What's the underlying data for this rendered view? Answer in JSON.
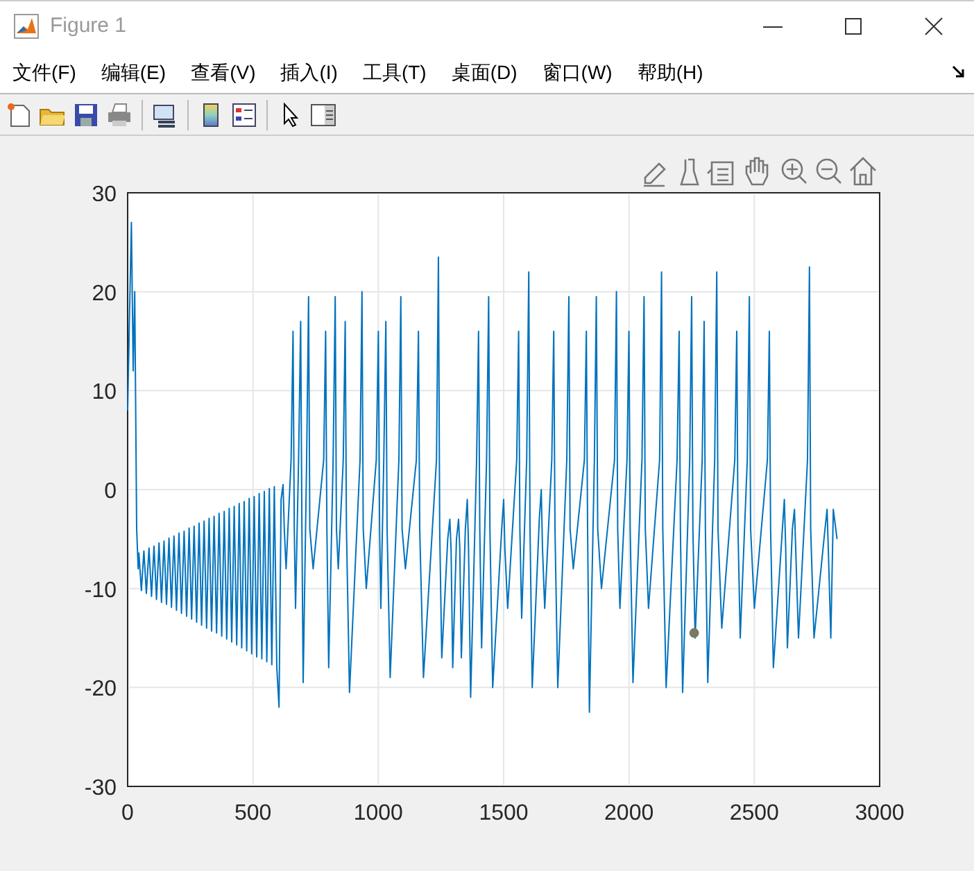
{
  "window": {
    "title": "Figure 1"
  },
  "menu": [
    "文件(F)",
    "编辑(E)",
    "查看(V)",
    "插入(I)",
    "工具(T)",
    "桌面(D)",
    "窗口(W)",
    "帮助(H)"
  ],
  "chart_data": {
    "type": "line",
    "grid": true,
    "xlim": [
      0,
      3000
    ],
    "ylim": [
      -30,
      30
    ],
    "xticks": [
      0,
      500,
      1000,
      1500,
      2000,
      2500,
      3000
    ],
    "yticks": [
      -30,
      -20,
      -10,
      0,
      10,
      20,
      30
    ],
    "x": [
      0,
      8,
      15,
      22,
      28,
      36,
      42,
      45,
      55,
      65,
      75,
      85,
      95,
      105,
      115,
      125,
      135,
      145,
      155,
      165,
      175,
      185,
      195,
      205,
      215,
      225,
      235,
      245,
      255,
      265,
      275,
      285,
      295,
      305,
      315,
      325,
      335,
      345,
      355,
      365,
      375,
      385,
      395,
      405,
      415,
      425,
      435,
      445,
      455,
      465,
      475,
      485,
      495,
      505,
      515,
      525,
      535,
      545,
      555,
      565,
      575,
      585,
      595,
      604,
      612,
      620,
      625,
      632,
      652,
      660,
      665,
      670,
      682,
      690,
      695,
      700,
      714,
      722,
      727,
      740,
      782,
      790,
      795,
      802,
      820,
      828,
      833,
      840,
      860,
      868,
      873,
      885,
      927,
      935,
      940,
      952,
      992,
      1000,
      1005,
      1010,
      1022,
      1030,
      1035,
      1047,
      1082,
      1090,
      1095,
      1108,
      1152,
      1160,
      1165,
      1180,
      1232,
      1240,
      1245,
      1253,
      1277,
      1285,
      1290,
      1297,
      1312,
      1320,
      1325,
      1331,
      1347,
      1355,
      1360,
      1368,
      1392,
      1400,
      1405,
      1412,
      1432,
      1440,
      1445,
      1456,
      1492,
      1500,
      1505,
      1516,
      1552,
      1560,
      1565,
      1572,
      1592,
      1600,
      1605,
      1614,
      1642,
      1650,
      1655,
      1664,
      1692,
      1700,
      1705,
      1716,
      1752,
      1760,
      1765,
      1778,
      1822,
      1830,
      1835,
      1842,
      1862,
      1870,
      1875,
      1890,
      1942,
      1950,
      1955,
      1964,
      1992,
      2000,
      2005,
      2016,
      2052,
      2060,
      2065,
      2078,
      2122,
      2130,
      2135,
      2148,
      2192,
      2200,
      2205,
      2214,
      2242,
      2250,
      2255,
      2264,
      2292,
      2300,
      2305,
      2314,
      2342,
      2350,
      2355,
      2370,
      2422,
      2430,
      2435,
      2444,
      2472,
      2480,
      2485,
      2500,
      2552,
      2560,
      2565,
      2576,
      2612,
      2620,
      2625,
      2632,
      2652,
      2660,
      2665,
      2676,
      2712,
      2720,
      2725,
      2738,
      2782,
      2790,
      2795,
      2805,
      2815,
      2830
    ],
    "series": [
      {
        "color": "#0072bd",
        "values": [
          8,
          18,
          27,
          12,
          20,
          -4,
          -8,
          -6.4,
          -10.2,
          -6.2,
          -10.5,
          -5.9,
          -10.8,
          -5.7,
          -11.1,
          -5.4,
          -11.4,
          -5.2,
          -11.6,
          -4.9,
          -11.9,
          -4.7,
          -12.2,
          -4.4,
          -12.5,
          -4.2,
          -12.8,
          -3.9,
          -13.1,
          -3.7,
          -13.4,
          -3.4,
          -13.7,
          -3.2,
          -14,
          -2.9,
          -14.3,
          -2.7,
          -14.5,
          -2.4,
          -14.8,
          -2.2,
          -15.1,
          -1.9,
          -15.4,
          -1.7,
          -15.7,
          -1.4,
          -16,
          -1.2,
          -16.3,
          -0.9,
          -16.6,
          -0.7,
          -16.9,
          -0.4,
          -17.1,
          -0.2,
          -17.4,
          0.1,
          -17.7,
          0.3,
          -18,
          -22,
          -1,
          0.5,
          -4,
          -8,
          3,
          16,
          -4,
          -12,
          3,
          17,
          -4,
          -19.5,
          3,
          19.5,
          -4,
          -8,
          3,
          16,
          -4,
          -18,
          3,
          19.5,
          -4,
          -8,
          3,
          17,
          -4,
          -20.5,
          3,
          20,
          -4,
          -10,
          3,
          16,
          -4,
          -12,
          3,
          17,
          -4,
          -19,
          3,
          19.5,
          -4,
          -8,
          3,
          16,
          -4,
          -19,
          3,
          23.5,
          -4,
          -17,
          -5,
          -3,
          -6,
          -18,
          -5,
          -3,
          -6,
          -17,
          -4,
          -1,
          -6,
          -21,
          3,
          16,
          -4,
          -16,
          3,
          19.5,
          -4,
          -20,
          -4,
          -1,
          -6,
          -12,
          3,
          16,
          -4,
          -13,
          3,
          22,
          -4,
          -20,
          -3,
          0,
          -6,
          -12,
          3,
          16,
          -4,
          -20,
          3,
          19.5,
          -4,
          -8,
          3,
          16,
          -4,
          -22.5,
          3,
          19.5,
          -4,
          -10,
          3,
          20,
          -4,
          -12,
          3,
          16,
          -4,
          -19.5,
          3,
          19.5,
          -4,
          -12,
          3,
          22,
          -4,
          -20,
          3,
          16,
          -4,
          -20.5,
          3,
          19.5,
          -4,
          -15,
          3,
          17,
          -4,
          -19.5,
          3,
          22,
          -4,
          -14,
          3,
          16,
          -4,
          -15,
          3,
          19.5,
          -4,
          -12,
          3,
          16,
          -4,
          -18,
          -4,
          -1,
          -6,
          -16,
          -4,
          -2,
          -6,
          -15,
          3,
          22.5,
          -4,
          -15,
          -4,
          -2,
          -6,
          -15,
          -2,
          -5
        ]
      }
    ]
  }
}
